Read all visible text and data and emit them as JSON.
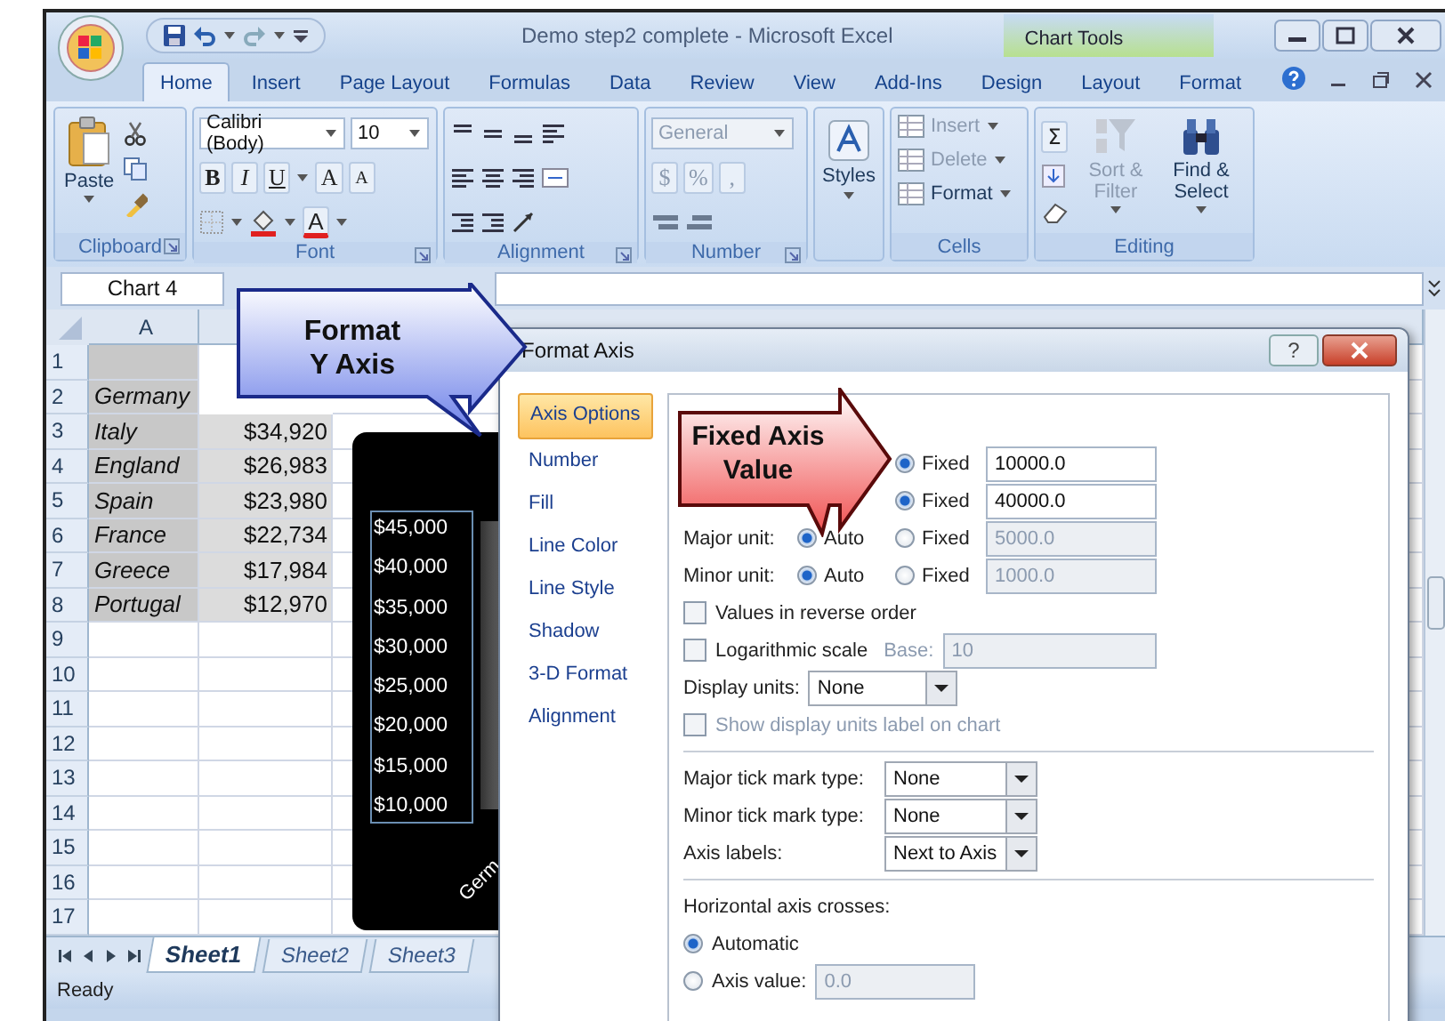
{
  "window": {
    "title": "Demo step2 complete - Microsoft Excel",
    "context_group": "Chart Tools"
  },
  "ribbon_tabs": [
    {
      "label": "Home",
      "selected": true
    },
    {
      "label": "Insert",
      "selected": false
    },
    {
      "label": "Page Layout",
      "selected": false
    },
    {
      "label": "Formulas",
      "selected": false
    },
    {
      "label": "Data",
      "selected": false
    },
    {
      "label": "Review",
      "selected": false
    },
    {
      "label": "View",
      "selected": false
    },
    {
      "label": "Add-Ins",
      "selected": false
    },
    {
      "label": "Design",
      "selected": false
    },
    {
      "label": "Layout",
      "selected": false
    },
    {
      "label": "Format",
      "selected": false
    }
  ],
  "ribbon_groups": [
    {
      "kind": "clipboard",
      "label": "Clipboard",
      "paste": "Paste"
    },
    {
      "kind": "font",
      "label": "Font",
      "font_name": "Calibri (Body)",
      "font_size": "10",
      "styles": [
        "B",
        "I",
        "U"
      ],
      "sizes": [
        "A",
        "A"
      ],
      "font_color": "A"
    },
    {
      "kind": "alignment",
      "label": "Alignment"
    },
    {
      "kind": "number",
      "label": "Number",
      "format": "General",
      "symbols": [
        "$",
        "%",
        ","
      ]
    },
    {
      "kind": "styles",
      "label": "Styles"
    },
    {
      "kind": "cells",
      "label": "Cells",
      "buttons": [
        {
          "label": "Insert",
          "disabled": true
        },
        {
          "label": "Delete",
          "disabled": true
        },
        {
          "label": "Format",
          "disabled": false
        }
      ]
    },
    {
      "kind": "editing",
      "label": "Editing",
      "sum": "Σ",
      "buttons": [
        {
          "label": "Sort & Filter",
          "disabled": true
        },
        {
          "label": "Find & Select",
          "disabled": false
        }
      ]
    }
  ],
  "name_box": "Chart 4",
  "sheet": {
    "columns": [
      "A"
    ],
    "rows": [
      {
        "number": "1"
      },
      {
        "number": "2",
        "country": "Germany"
      },
      {
        "number": "3",
        "country": "Italy",
        "value": "$34,920"
      },
      {
        "number": "4",
        "country": "England",
        "value": "$26,983"
      },
      {
        "number": "5",
        "country": "Spain",
        "value": "$23,980"
      },
      {
        "number": "6",
        "country": "France",
        "value": "$22,734"
      },
      {
        "number": "7",
        "country": "Greece",
        "value": "$17,984"
      },
      {
        "number": "8",
        "country": "Portugal",
        "value": "$12,970"
      },
      {
        "number": "9"
      },
      {
        "number": "10"
      },
      {
        "number": "11"
      },
      {
        "number": "12"
      },
      {
        "number": "13"
      },
      {
        "number": "14"
      },
      {
        "number": "15"
      },
      {
        "number": "16"
      },
      {
        "number": "17"
      }
    ]
  },
  "chart": {
    "axis_labels": [
      "$45,000",
      "$40,000",
      "$35,000",
      "$30,000",
      "$25,000",
      "$20,000",
      "$15,000",
      "$10,000"
    ],
    "category_label": "Germ"
  },
  "sheet_tabs": [
    {
      "label": "Sheet1",
      "selected": true
    },
    {
      "label": "Sheet2",
      "selected": false
    },
    {
      "label": "Sheet3",
      "selected": false
    }
  ],
  "status_bar": "Ready",
  "dialog": {
    "title": "Format Axis",
    "help": "?",
    "categories": [
      {
        "label": "Axis Options",
        "selected": true
      },
      {
        "label": "Number",
        "selected": false
      },
      {
        "label": "Fill",
        "selected": false
      },
      {
        "label": "Line Color",
        "selected": false
      },
      {
        "label": "Line Style",
        "selected": false
      },
      {
        "label": "Shadow",
        "selected": false
      },
      {
        "label": "3-D Format",
        "selected": false
      },
      {
        "label": "Alignment",
        "selected": false
      }
    ],
    "options": [
      {
        "kind": "axis_value",
        "radios": [
          {
            "label": "Fixed",
            "selected": true
          }
        ],
        "value": "10000.0",
        "disabled": false
      },
      {
        "kind": "axis_value",
        "radios": [
          {
            "label": "Fixed",
            "selected": true
          }
        ],
        "value": "40000.0",
        "disabled": false
      },
      {
        "kind": "axis_value",
        "label": "Major unit:",
        "radios": [
          {
            "label": "Auto",
            "selected": true
          },
          {
            "label": "Fixed",
            "selected": false
          }
        ],
        "value": "5000.0",
        "disabled": true
      },
      {
        "kind": "axis_value",
        "label": "Minor unit:",
        "radios": [
          {
            "label": "Auto",
            "selected": true
          },
          {
            "label": "Fixed",
            "selected": false
          }
        ],
        "value": "1000.0",
        "disabled": true
      },
      {
        "kind": "checkbox",
        "label": "Values in reverse order",
        "checked": false,
        "disabled": false
      },
      {
        "kind": "checkbox",
        "label": "Logarithmic scale",
        "checked": false,
        "disabled": false,
        "extra_label": "Base:",
        "value": "10"
      },
      {
        "kind": "dropdown_inline",
        "label": "Display units:",
        "value": "None"
      },
      {
        "kind": "checkbox",
        "label": "Show display units label on chart",
        "checked": false,
        "disabled": true
      },
      {
        "kind": "separator"
      },
      {
        "kind": "dropdown",
        "label": "Major tick mark type:",
        "value": "None"
      },
      {
        "kind": "dropdown",
        "label": "Minor tick mark type:",
        "value": "None"
      },
      {
        "kind": "dropdown",
        "label": "Axis labels:",
        "value": "Next to Axis"
      },
      {
        "kind": "separator"
      },
      {
        "kind": "heading",
        "label": "Horizontal axis crosses:"
      },
      {
        "kind": "radio",
        "label": "Automatic",
        "selected": true
      },
      {
        "kind": "radio",
        "label": "Axis value:",
        "selected": false,
        "value": "0.0"
      }
    ]
  },
  "callouts": [
    {
      "kind": "blue",
      "text": "Format\nY Axis"
    },
    {
      "kind": "red",
      "text": "Fixed Axis\nValue"
    }
  ]
}
